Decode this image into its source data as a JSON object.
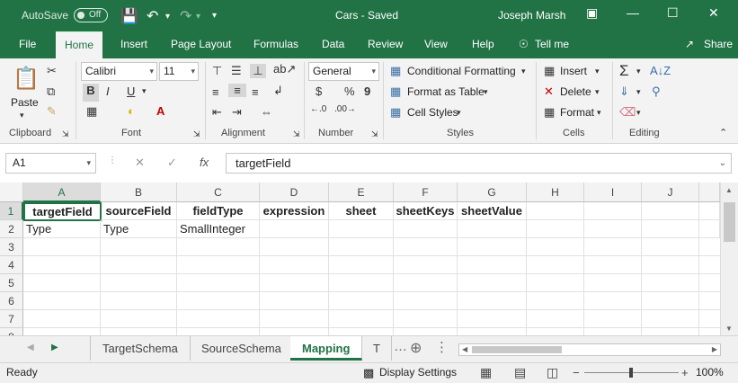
{
  "titlebar": {
    "autosave": "AutoSave",
    "autosave_state": "Off",
    "doc_title": "Cars  -  Saved",
    "user": "Joseph Marsh"
  },
  "tabs": [
    "File",
    "Home",
    "Insert",
    "Page Layout",
    "Formulas",
    "Data",
    "Review",
    "View",
    "Help"
  ],
  "tell_me": "Tell me",
  "share": "Share",
  "ribbon": {
    "clipboard": {
      "label": "Clipboard",
      "paste": "Paste"
    },
    "font": {
      "label": "Font",
      "name": "Calibri",
      "size": "11",
      "bold": "B",
      "italic": "I",
      "underline": "U"
    },
    "alignment": {
      "label": "Alignment"
    },
    "number": {
      "label": "Number",
      "format": "General",
      "currency": "$",
      "percent": "%",
      "comma": "9"
    },
    "styles": {
      "label": "Styles",
      "conditional": "Conditional Formatting",
      "format_table": "Format as Table",
      "cell_styles": "Cell Styles"
    },
    "cells": {
      "label": "Cells",
      "insert": "Insert",
      "delete": "Delete",
      "format": "Format"
    },
    "editing": {
      "label": "Editing"
    }
  },
  "formula_bar": {
    "name_box": "A1",
    "fx": "fx",
    "value": "targetField"
  },
  "columns": [
    "A",
    "B",
    "C",
    "D",
    "E",
    "F",
    "G",
    "H",
    "I",
    "J"
  ],
  "rows": [
    "1",
    "2",
    "3",
    "4",
    "5",
    "6",
    "7",
    "8"
  ],
  "cells": {
    "r1": [
      "targetField",
      "sourceField",
      "fieldType",
      "expression",
      "sheet",
      "sheetKeys",
      "sheetValue"
    ],
    "r2": [
      "Type",
      "Type",
      "SmallInteger"
    ]
  },
  "sheets": [
    "TargetSchema",
    "SourceSchema",
    "Mapping",
    "T"
  ],
  "active_sheet": "Mapping",
  "status": {
    "ready": "Ready",
    "display_settings": "Display Settings",
    "zoom": "100%"
  },
  "colors": {
    "accent": "#217346"
  }
}
